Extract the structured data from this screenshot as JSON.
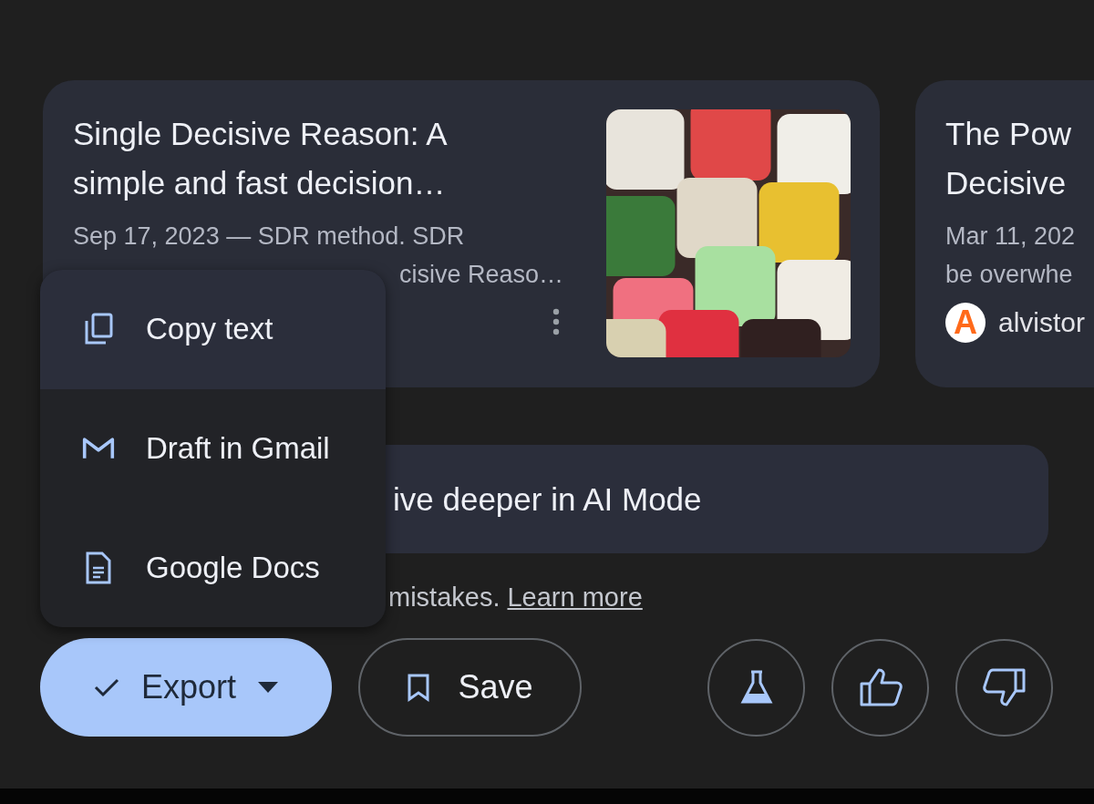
{
  "cards": [
    {
      "title_lines": [
        "Single Decisive Reason: A",
        "simple and fast decision…"
      ],
      "snippet_lines": [
        "Sep 17, 2023 — SDR method. SDR"
      ],
      "snippet_tail": "cisive Reaso…",
      "has_picture": true,
      "has_more_button": true
    },
    {
      "title_lines": [
        "The Pow",
        "Decisive"
      ],
      "snippet_lines": [
        "Mar 11, 202",
        "be overwhe"
      ],
      "source": {
        "avatar_letter": "A",
        "name": "alvistor"
      },
      "has_picture": false,
      "has_more_button": false
    }
  ],
  "ai_mode_bar": {
    "label": "ive deeper in AI Mode"
  },
  "disclaimer": {
    "text": "mistakes.",
    "link": "Learn more"
  },
  "export_menu": [
    {
      "kind": "copy",
      "label": "Copy text",
      "selected": true
    },
    {
      "kind": "gmail",
      "label": "Draft in Gmail",
      "selected": false
    },
    {
      "kind": "docs",
      "label": "Google Docs",
      "selected": false
    }
  ],
  "actions": {
    "export": {
      "label": "Export",
      "expanded": true
    },
    "save": {
      "label": "Save"
    },
    "icon_buttons": [
      {
        "kind": "labs"
      },
      {
        "kind": "thumb_up"
      },
      {
        "kind": "thumb_down"
      }
    ]
  }
}
